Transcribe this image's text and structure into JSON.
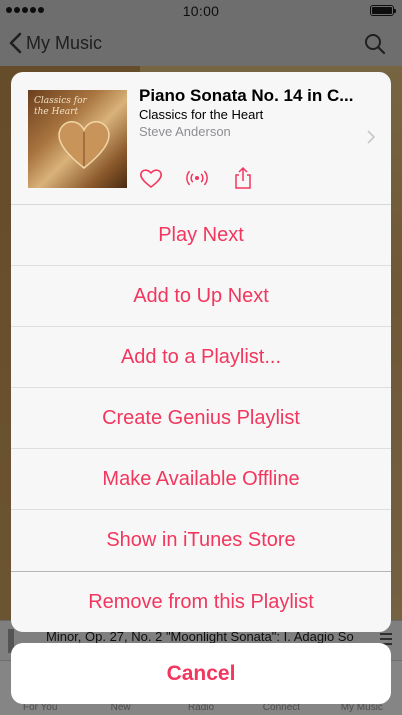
{
  "status_bar": {
    "time": "10:00"
  },
  "nav": {
    "back_label": "My Music"
  },
  "now_playing_bg": {
    "text": "Minor, Op. 27, No. 2 \"Moonlight Sonata\": I. Adagio So"
  },
  "tabs": [
    {
      "label": "For You"
    },
    {
      "label": "New"
    },
    {
      "label": "Radio"
    },
    {
      "label": "Connect"
    },
    {
      "label": "My Music"
    }
  ],
  "sheet": {
    "song_title": "Piano Sonata No. 14 in C...",
    "album": "Classics for the Heart",
    "artist": "Steve Anderson",
    "album_art_text": "Classics for the Heart",
    "items": [
      {
        "label": "Play Next"
      },
      {
        "label": "Add to Up Next"
      },
      {
        "label": "Add to a Playlist..."
      },
      {
        "label": "Create Genius Playlist"
      },
      {
        "label": "Make Available Offline"
      },
      {
        "label": "Show in iTunes Store"
      },
      {
        "label": "Remove from this Playlist"
      }
    ],
    "cancel_label": "Cancel"
  },
  "colors": {
    "accent": "#f2365e",
    "secondary_text": "#8e8e93"
  }
}
